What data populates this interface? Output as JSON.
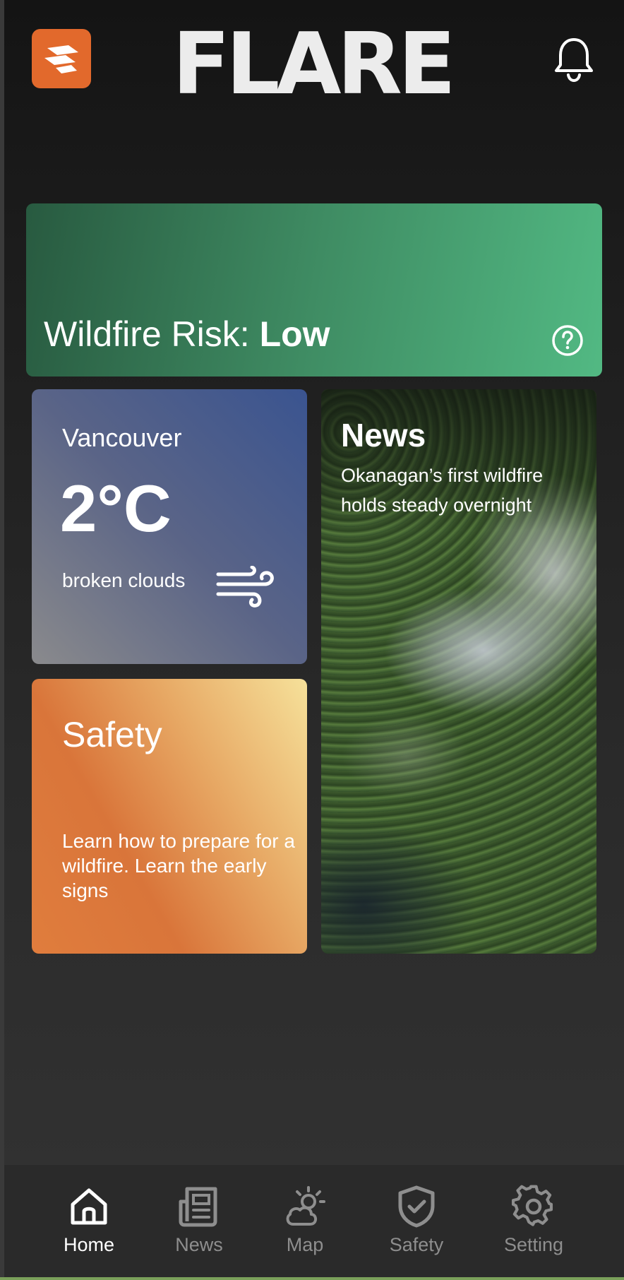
{
  "header": {
    "brand": "FLARE",
    "logo_icon": "flare-logo-icon",
    "notification_icon": "bell-icon"
  },
  "risk": {
    "label": "Wildfire Risk: ",
    "level": "Low",
    "help_icon": "question-circle-icon",
    "colors": [
      "#285a40",
      "#52b983"
    ]
  },
  "weather": {
    "city": "Vancouver",
    "temperature": "2°C",
    "condition": "broken clouds",
    "icon": "wind-icon"
  },
  "safety": {
    "title": "Safety",
    "description": "Learn how to prepare for a wildfire. Learn the early signs"
  },
  "news": {
    "title": "News",
    "headline": "Okanagan’s first wildfire holds steady overnight"
  },
  "nav": {
    "items": [
      {
        "label": "Home",
        "icon": "home-icon",
        "active": true
      },
      {
        "label": "News",
        "icon": "newspaper-icon",
        "active": false
      },
      {
        "label": "Map",
        "icon": "weather-map-icon",
        "active": false
      },
      {
        "label": "Safety",
        "icon": "shield-check-icon",
        "active": false
      },
      {
        "label": "Setting",
        "icon": "gear-icon",
        "active": false
      }
    ]
  },
  "colors": {
    "accent": "#e2692c",
    "background": "#141414"
  }
}
